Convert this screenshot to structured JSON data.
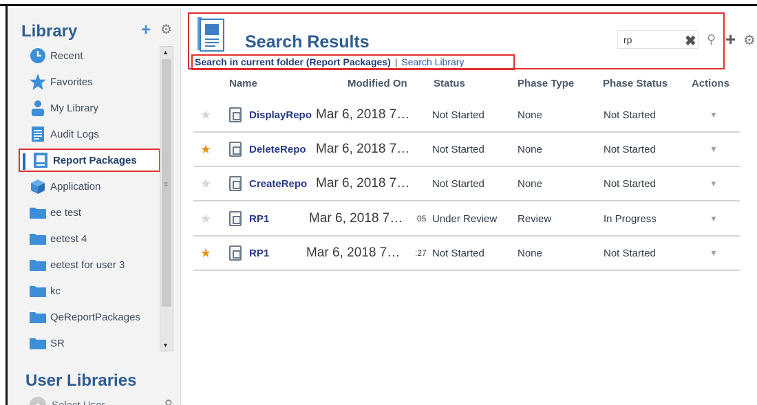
{
  "sidebar": {
    "title": "Library",
    "add_icon": "plus-icon",
    "gear_icon": "gear-icon",
    "items": [
      {
        "label": "Recent",
        "icon": "clock-icon"
      },
      {
        "label": "Favorites",
        "icon": "star-icon"
      },
      {
        "label": "My Library",
        "icon": "user-icon"
      },
      {
        "label": "Audit Logs",
        "icon": "log-icon"
      },
      {
        "label": "Report Packages",
        "icon": "report-package-icon",
        "selected": true
      },
      {
        "label": "Application",
        "icon": "cube-icon"
      },
      {
        "label": "ee test",
        "icon": "folder-icon"
      },
      {
        "label": "eetest 4",
        "icon": "folder-icon"
      },
      {
        "label": "eetest for user 3",
        "icon": "folder-icon"
      },
      {
        "label": "kc",
        "icon": "folder-icon"
      },
      {
        "label": "QeReportPackages",
        "icon": "folder-icon"
      },
      {
        "label": "SR",
        "icon": "folder-icon"
      }
    ],
    "user_libraries_title": "User Libraries",
    "select_user_label": "Select User"
  },
  "header": {
    "title": "Search Results",
    "search_value": "rp",
    "scope_current": "Search in current folder (Report Packages)",
    "scope_separator": "|",
    "scope_library": "Search Library"
  },
  "table": {
    "columns": [
      "Name",
      "Modified On",
      "Status",
      "Phase Type",
      "Phase Status",
      "Actions"
    ],
    "rows": [
      {
        "favorite": false,
        "name": "DisplayRepo",
        "modified": "Mar 6, 2018 7…",
        "status": "Not Started",
        "phase_type": "None",
        "phase_status": "Not Started"
      },
      {
        "favorite": true,
        "name": "DeleteRepo",
        "modified": "Mar 6, 2018 7…",
        "status": "Not Started",
        "phase_type": "None",
        "phase_status": "Not Started"
      },
      {
        "favorite": false,
        "name": "CreateRepo",
        "modified": "Mar 6, 2018 7…",
        "status": "Not Started",
        "phase_type": "None",
        "phase_status": "Not Started"
      },
      {
        "favorite": false,
        "name": "RP1",
        "modified": "Mar 6, 2018 7…",
        "modified_tail": "05",
        "status": "Under Review",
        "phase_type": "Review",
        "phase_status": "In Progress"
      },
      {
        "favorite": true,
        "name": "RP1",
        "modified": "Mar 6, 2018 7…",
        "modified_tail": ":27",
        "status": "Not Started",
        "phase_type": "None",
        "phase_status": "Not Started"
      }
    ]
  },
  "colors": {
    "accent": "#2e5d92",
    "highlight_border": "#e03030",
    "favorite_star": "#e89320"
  }
}
